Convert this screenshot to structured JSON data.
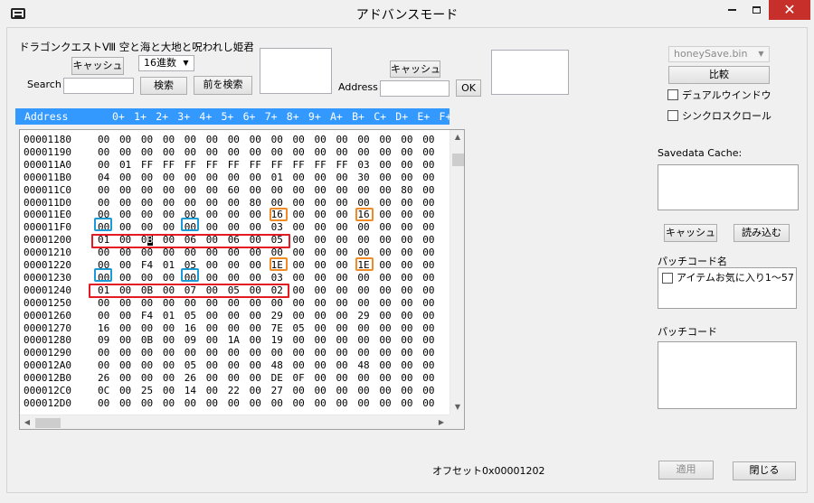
{
  "window": {
    "title": "アドバンスモード"
  },
  "top": {
    "game_title": "ドラゴンクエストⅧ 空と海と大地と呪われし姫君",
    "cache_button_1": "キャッシュ",
    "mode_select": "16進数",
    "search_label": "Search",
    "search_value": "",
    "search_button": "検索",
    "prev_search_button": "前を検索",
    "cache_button_2": "キャッシュ",
    "address_label": "Address",
    "address_value": "",
    "ok_button": "OK"
  },
  "right": {
    "file_select": "honeySave.bin",
    "compare_button": "比較",
    "dual_window_label": "デュアルウインドウ",
    "sync_scroll_label": "シンクロスクロール",
    "savedata_cache_label": "Savedata Cache:",
    "cache_button": "キャッシュ",
    "load_button": "読み込む",
    "patch_name_label": "パッチコード名",
    "patch_item": "アイテムお気に入り1〜57",
    "patch_code_label": "パッチコード",
    "apply_button": "適用",
    "close_button": "閉じる"
  },
  "status": {
    "offset": "オフセット0x00001202"
  },
  "hex": {
    "header_address": "Address",
    "columns": [
      "0+",
      "1+",
      "2+",
      "3+",
      "4+",
      "5+",
      "6+",
      "7+",
      "8+",
      "9+",
      "A+",
      "B+",
      "C+",
      "D+",
      "E+",
      "F+"
    ],
    "rows": [
      {
        "addr": "00001180",
        "bytes": [
          "00",
          "00",
          "00",
          "00",
          "00",
          "00",
          "00",
          "00",
          "00",
          "00",
          "00",
          "00",
          "00",
          "00",
          "00",
          "00"
        ]
      },
      {
        "addr": "00001190",
        "bytes": [
          "00",
          "00",
          "00",
          "00",
          "00",
          "00",
          "00",
          "00",
          "00",
          "00",
          "00",
          "00",
          "00",
          "00",
          "00",
          "00"
        ]
      },
      {
        "addr": "000011A0",
        "bytes": [
          "00",
          "01",
          "FF",
          "FF",
          "FF",
          "FF",
          "FF",
          "FF",
          "FF",
          "FF",
          "FF",
          "FF",
          "03",
          "00",
          "00",
          "00"
        ]
      },
      {
        "addr": "000011B0",
        "bytes": [
          "04",
          "00",
          "00",
          "00",
          "00",
          "00",
          "00",
          "00",
          "01",
          "00",
          "00",
          "00",
          "30",
          "00",
          "00",
          "00"
        ]
      },
      {
        "addr": "000011C0",
        "bytes": [
          "00",
          "00",
          "00",
          "00",
          "00",
          "00",
          "60",
          "00",
          "00",
          "00",
          "00",
          "00",
          "00",
          "00",
          "80",
          "00"
        ]
      },
      {
        "addr": "000011D0",
        "bytes": [
          "00",
          "00",
          "00",
          "00",
          "00",
          "00",
          "00",
          "80",
          "00",
          "00",
          "00",
          "00",
          "00",
          "00",
          "00",
          "00"
        ]
      },
      {
        "addr": "000011E0",
        "bytes": [
          "00",
          "00",
          "00",
          "00",
          "00",
          "00",
          "00",
          "00",
          "16",
          "00",
          "00",
          "00",
          "16",
          "00",
          "00",
          "00"
        ]
      },
      {
        "addr": "000011F0",
        "bytes": [
          "00",
          "00",
          "00",
          "00",
          "00",
          "00",
          "00",
          "00",
          "03",
          "00",
          "00",
          "00",
          "00",
          "00",
          "00",
          "00"
        ]
      },
      {
        "addr": "00001200",
        "bytes": [
          "01",
          "00",
          "0B",
          "00",
          "06",
          "00",
          "06",
          "00",
          "05",
          "00",
          "00",
          "00",
          "00",
          "00",
          "00",
          "00"
        ]
      },
      {
        "addr": "00001210",
        "bytes": [
          "00",
          "00",
          "00",
          "00",
          "00",
          "00",
          "00",
          "00",
          "00",
          "00",
          "00",
          "00",
          "00",
          "00",
          "00",
          "00"
        ]
      },
      {
        "addr": "00001220",
        "bytes": [
          "00",
          "00",
          "F4",
          "01",
          "05",
          "00",
          "00",
          "00",
          "1E",
          "00",
          "00",
          "00",
          "1E",
          "00",
          "00",
          "00"
        ]
      },
      {
        "addr": "00001230",
        "bytes": [
          "00",
          "00",
          "00",
          "00",
          "00",
          "00",
          "00",
          "00",
          "03",
          "00",
          "00",
          "00",
          "00",
          "00",
          "00",
          "00"
        ]
      },
      {
        "addr": "00001240",
        "bytes": [
          "01",
          "00",
          "0B",
          "00",
          "07",
          "00",
          "05",
          "00",
          "02",
          "00",
          "00",
          "00",
          "00",
          "00",
          "00",
          "00"
        ]
      },
      {
        "addr": "00001250",
        "bytes": [
          "00",
          "00",
          "00",
          "00",
          "00",
          "00",
          "00",
          "00",
          "00",
          "00",
          "00",
          "00",
          "00",
          "00",
          "00",
          "00"
        ]
      },
      {
        "addr": "00001260",
        "bytes": [
          "00",
          "00",
          "F4",
          "01",
          "05",
          "00",
          "00",
          "00",
          "29",
          "00",
          "00",
          "00",
          "29",
          "00",
          "00",
          "00"
        ]
      },
      {
        "addr": "00001270",
        "bytes": [
          "16",
          "00",
          "00",
          "00",
          "16",
          "00",
          "00",
          "00",
          "7E",
          "05",
          "00",
          "00",
          "00",
          "00",
          "00",
          "00"
        ]
      },
      {
        "addr": "00001280",
        "bytes": [
          "09",
          "00",
          "0B",
          "00",
          "09",
          "00",
          "1A",
          "00",
          "19",
          "00",
          "00",
          "00",
          "00",
          "00",
          "00",
          "00"
        ]
      },
      {
        "addr": "00001290",
        "bytes": [
          "00",
          "00",
          "00",
          "00",
          "00",
          "00",
          "00",
          "00",
          "00",
          "00",
          "00",
          "00",
          "00",
          "00",
          "00",
          "00"
        ]
      },
      {
        "addr": "000012A0",
        "bytes": [
          "00",
          "00",
          "00",
          "00",
          "05",
          "00",
          "00",
          "00",
          "48",
          "00",
          "00",
          "00",
          "48",
          "00",
          "00",
          "00"
        ]
      },
      {
        "addr": "000012B0",
        "bytes": [
          "26",
          "00",
          "00",
          "00",
          "26",
          "00",
          "00",
          "00",
          "DE",
          "0F",
          "00",
          "00",
          "00",
          "00",
          "00",
          "00"
        ]
      },
      {
        "addr": "000012C0",
        "bytes": [
          "0C",
          "00",
          "25",
          "00",
          "14",
          "00",
          "22",
          "00",
          "27",
          "00",
          "00",
          "00",
          "00",
          "00",
          "00",
          "00"
        ]
      },
      {
        "addr": "000012D0",
        "bytes": [
          "00",
          "00",
          "00",
          "00",
          "00",
          "00",
          "00",
          "00",
          "00",
          "00",
          "00",
          "00",
          "00",
          "00",
          "00",
          "00"
        ]
      }
    ]
  },
  "colors": {
    "header_bg": "#3399ff",
    "highlight_red": "#e31b23",
    "highlight_orange": "#f08c28",
    "highlight_blue": "#1c9ad6",
    "close_button": "#c7302a"
  }
}
